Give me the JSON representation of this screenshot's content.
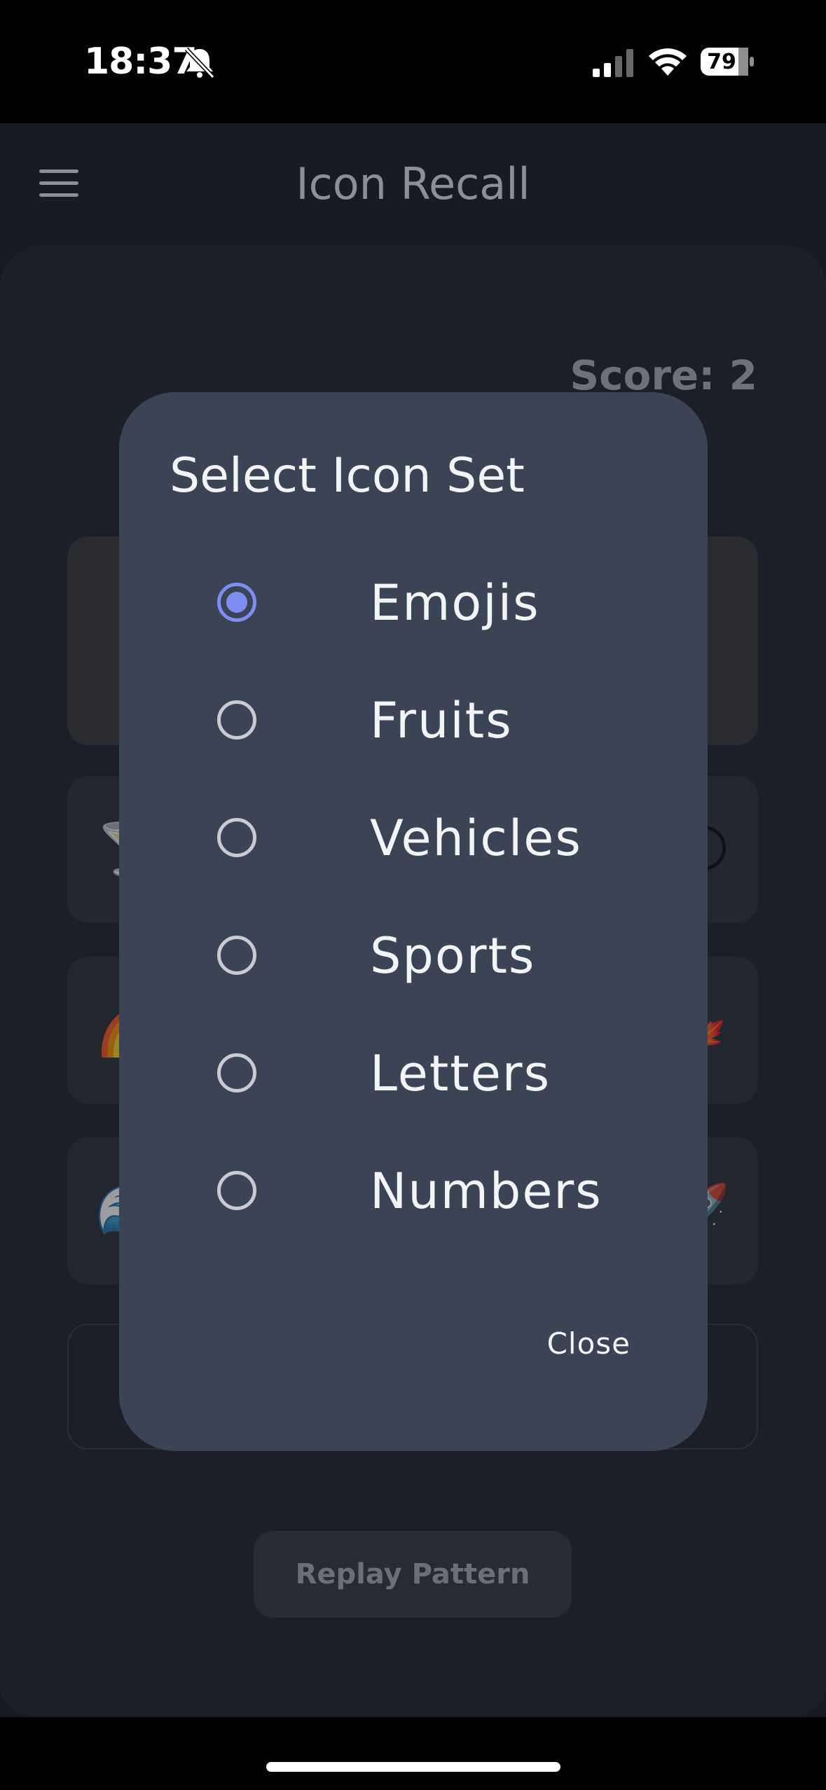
{
  "status_bar": {
    "time": "18:37",
    "battery": "79",
    "icons": [
      "bell-off-icon",
      "signal-icon",
      "wifi-icon",
      "battery-icon"
    ]
  },
  "app": {
    "title": "Icon Recall",
    "score": "Score: 2",
    "replay_label": "Replay Pattern",
    "row_emojis": {
      "row1": [
        "🍸",
        "🌕"
      ],
      "row2": [
        "🌈",
        "🍁"
      ],
      "row3": [
        "🌊",
        "🚀"
      ]
    }
  },
  "dialog": {
    "title": "Select Icon Set",
    "options": [
      {
        "label": "Emojis",
        "selected": true
      },
      {
        "label": "Fruits",
        "selected": false
      },
      {
        "label": "Vehicles",
        "selected": false
      },
      {
        "label": "Sports",
        "selected": false
      },
      {
        "label": "Letters",
        "selected": false
      },
      {
        "label": "Numbers",
        "selected": false
      }
    ],
    "close_label": "Close"
  },
  "colors": {
    "accent": "#7f8cf2",
    "dialog_bg": "#3b4454",
    "app_bg": "#161a21"
  }
}
